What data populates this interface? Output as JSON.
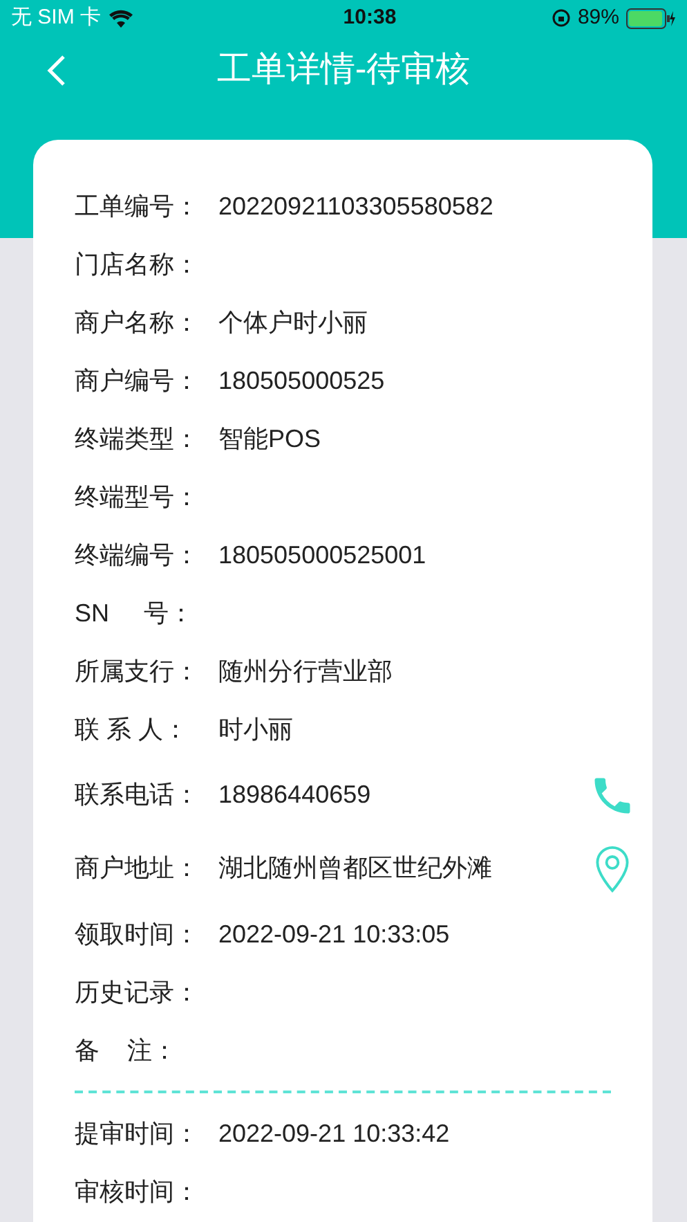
{
  "status_bar": {
    "carrier": "无 SIM 卡",
    "time": "10:38",
    "battery": "89%"
  },
  "nav": {
    "title": "工单详情-待审核"
  },
  "details": [
    {
      "label": "工单编号：",
      "value": "20220921103305580582"
    },
    {
      "label": "门店名称："
    },
    {
      "label": "商户名称：",
      "value": "个体户时小丽"
    },
    {
      "label": "商户编号：",
      "value": "180505000525"
    },
    {
      "label": "终端类型：",
      "value": "智能POS"
    },
    {
      "label": "终端型号："
    },
    {
      "label": "终端编号：",
      "value": "180505000525001"
    },
    {
      "label": "SN     号："
    },
    {
      "label": "所属支行：",
      "value": "随州分行营业部"
    },
    {
      "label": "联 系 人：",
      "value": "时小丽"
    },
    {
      "label": "联系电话：",
      "value": "18986440659",
      "kind": "phone"
    },
    {
      "label": "商户地址：",
      "value": "湖北随州曾都区世纪外滩",
      "kind": "location"
    },
    {
      "label": "领取时间：",
      "value": "2022-09-21 10:33:05"
    },
    {
      "label": "历史记录："
    },
    {
      "label": "备    注："
    }
  ],
  "review": [
    {
      "label": "提审时间：",
      "value": "2022-09-21 10:33:42"
    },
    {
      "label": "审核时间："
    }
  ]
}
